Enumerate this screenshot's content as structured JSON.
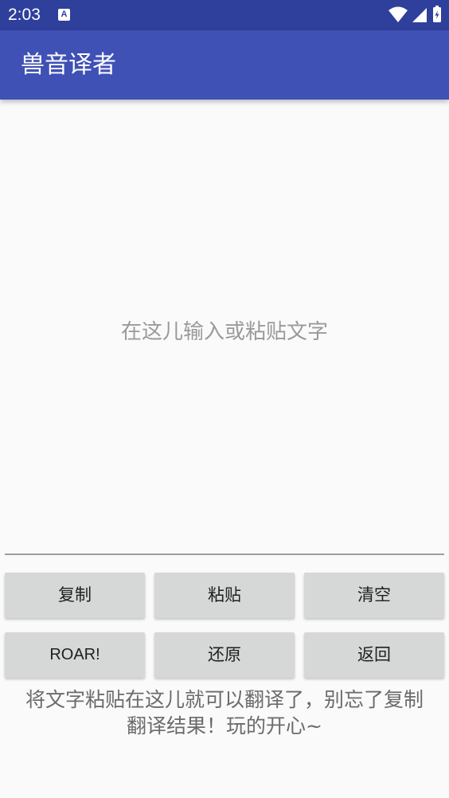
{
  "status_bar": {
    "time": "2:03",
    "notification_icon": "A",
    "icons": [
      "wifi-icon",
      "signal-icon",
      "battery-icon"
    ]
  },
  "app_bar": {
    "title": "兽音译者",
    "color": "#3f51b5"
  },
  "editor": {
    "value": "",
    "placeholder": "在这儿输入或粘贴文字"
  },
  "buttons": {
    "copy": "复制",
    "paste": "粘贴",
    "clear": "清空",
    "roar": "ROAR!",
    "restore": "还原",
    "back": "返回"
  },
  "footer": {
    "line1": "将文字粘贴在这儿就可以翻译了，别忘了复制",
    "line2": "翻译结果！玩的开心~"
  }
}
